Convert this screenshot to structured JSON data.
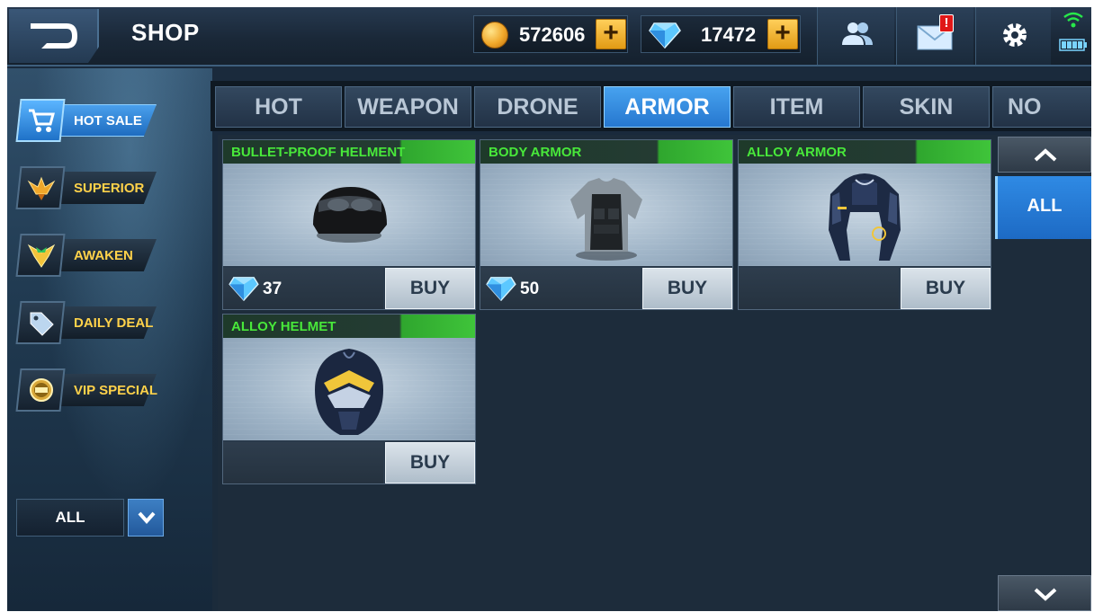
{
  "header": {
    "title": "SHOP",
    "gold_amount": "572606",
    "gem_amount": "17472",
    "plus_label": "+",
    "mail_alert": "!"
  },
  "sidebar": {
    "items": [
      {
        "label": "HOT SALE",
        "icon": "cart-icon",
        "active": true
      },
      {
        "label": "SUPERIOR",
        "icon": "winged-emblem-icon",
        "active": false
      },
      {
        "label": "AWAKEN",
        "icon": "awaken-emblem-icon",
        "active": false
      },
      {
        "label": "DAILY DEAL",
        "icon": "price-tag-icon",
        "active": false
      },
      {
        "label": "VIP SPECIAL",
        "icon": "vip-badge-icon",
        "active": false
      }
    ],
    "filter_value": "ALL"
  },
  "tabs": [
    {
      "label": "HOT",
      "active": false
    },
    {
      "label": "WEAPON",
      "active": false
    },
    {
      "label": "DRONE",
      "active": false
    },
    {
      "label": "ARMOR",
      "active": true
    },
    {
      "label": "ITEM",
      "active": false
    },
    {
      "label": "SKIN",
      "active": false
    },
    {
      "label": "NO SAL",
      "active": false
    }
  ],
  "items": [
    {
      "name": "BULLET-PROOF HELMENT",
      "price": "37",
      "buy": "BUY",
      "image": "helmet-image"
    },
    {
      "name": "BODY ARMOR",
      "price": "50",
      "buy": "BUY",
      "image": "body-armor-image"
    },
    {
      "name": "ALLOY ARMOR",
      "price": "",
      "buy": "BUY",
      "image": "alloy-armor-image"
    },
    {
      "name": "ALLOY HELMET",
      "price": "",
      "buy": "BUY",
      "image": "alloy-helmet-image"
    }
  ],
  "right_panel": {
    "category": "ALL"
  },
  "colors": {
    "accent_blue": "#2677cf",
    "item_name_green": "#48e83a",
    "gold": "#f0a72a",
    "alert_red": "#e01818"
  }
}
